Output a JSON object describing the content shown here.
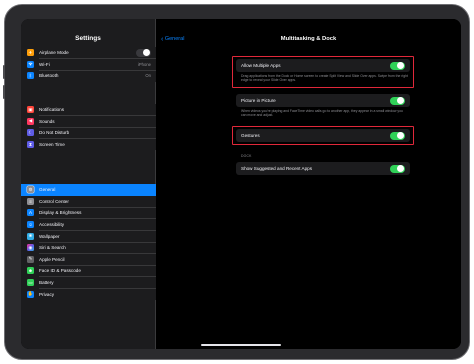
{
  "status": {
    "time": "8:50 PM",
    "date": "Tue Jul 2",
    "battery": "100%"
  },
  "sidebar": {
    "title": "Settings",
    "group1": [
      {
        "label": "Airplane Mode",
        "icon": "airplane-icon",
        "color": "#ff9f0a",
        "toggle": true
      },
      {
        "label": "Wi-Fi",
        "icon": "wifi-icon",
        "color": "#0a84ff",
        "value": "iPhone"
      },
      {
        "label": "Bluetooth",
        "icon": "bluetooth-icon",
        "color": "#0a84ff",
        "value": "On"
      }
    ],
    "group2": [
      {
        "label": "Notifications",
        "icon": "notifications-icon",
        "color": "#ff453a"
      },
      {
        "label": "Sounds",
        "icon": "sounds-icon",
        "color": "#ff375f"
      },
      {
        "label": "Do Not Disturb",
        "icon": "moon-icon",
        "color": "#5e5ce6"
      },
      {
        "label": "Screen Time",
        "icon": "hourglass-icon",
        "color": "#5e5ce6"
      }
    ],
    "group3": [
      {
        "label": "General",
        "icon": "gear-icon",
        "color": "#8e8e93",
        "active": true
      },
      {
        "label": "Control Center",
        "icon": "control-center-icon",
        "color": "#8e8e93"
      },
      {
        "label": "Display & Brightness",
        "icon": "display-icon",
        "color": "#0a84ff"
      },
      {
        "label": "Accessibility",
        "icon": "accessibility-icon",
        "color": "#0a84ff"
      },
      {
        "label": "Wallpaper",
        "icon": "wallpaper-icon",
        "color": "#32ade6"
      },
      {
        "label": "Siri & Search",
        "icon": "siri-icon",
        "color": "#2c2c2e"
      },
      {
        "label": "Apple Pencil",
        "icon": "pencil-icon",
        "color": "#636366"
      },
      {
        "label": "Face ID & Passcode",
        "icon": "face-id-icon",
        "color": "#30d158"
      },
      {
        "label": "Battery",
        "icon": "battery-icon",
        "color": "#30d158"
      },
      {
        "label": "Privacy",
        "icon": "privacy-icon",
        "color": "#0a84ff"
      }
    ]
  },
  "detail": {
    "back_label": "General",
    "title": "Multitasking & Dock",
    "allow_multiple_apps": {
      "label": "Allow Multiple Apps",
      "description": "Drag applications from the Dock or Home screen to create Split View and Slide Over apps. Swipe from the right edge to reveal your Slide Over apps."
    },
    "picture_in_picture": {
      "label": "Picture in Picture",
      "description": "When videos you're playing and FaceTime video calls go to another app, they appear in a small window you can move and adjust."
    },
    "gestures": {
      "label": "Gestures"
    },
    "dock_header": "DOCK",
    "show_suggested": {
      "label": "Show Suggested and Recent Apps"
    }
  },
  "colors": {
    "accent": "#0a84ff",
    "toggle_on": "#30d158",
    "highlight": "#e0283a"
  }
}
